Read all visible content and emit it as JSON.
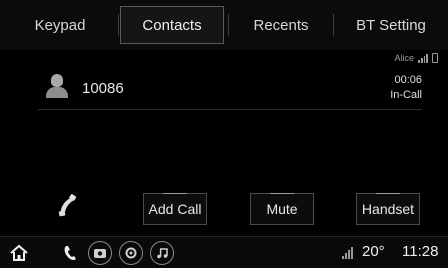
{
  "tabs": [
    {
      "label": "Keypad",
      "active": false
    },
    {
      "label": "Contacts",
      "active": true
    },
    {
      "label": "Recents",
      "active": false
    },
    {
      "label": "BT Setting",
      "active": false
    }
  ],
  "status": {
    "device_name": "Alice",
    "signal_icon": "signal-bars-icon",
    "phone_icon": "phone-battery-icon"
  },
  "call": {
    "number": "10086",
    "duration": "00:06",
    "state": "In-Call"
  },
  "actions": {
    "add_call": "Add Call",
    "mute": "Mute",
    "handset": "Handset"
  },
  "bottom_bar": {
    "icons": [
      "home-icon",
      "phone-icon",
      "camera-icon",
      "settings-icon",
      "music-icon"
    ],
    "temperature": "20°",
    "time": "11:28"
  },
  "colors": {
    "background": "#000000",
    "text": "#e6e6e6",
    "border": "#4a4a4a"
  }
}
